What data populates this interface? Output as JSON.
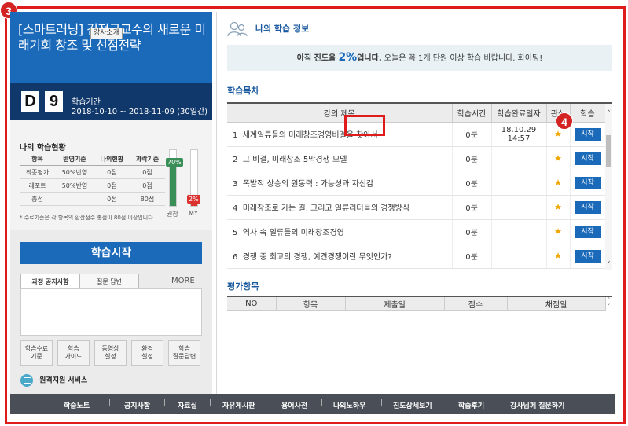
{
  "step_badges": {
    "a": "3",
    "b": "4"
  },
  "course": {
    "title": "[스마트러닝] 김정구교수의 새로운 미래기회 창조 및 선점전략",
    "intro_tag": "강사소개",
    "dday_letter": "D",
    "dday_number": "9",
    "period_label": "학습기간",
    "period_range": "2018-10-10 ~ 2018-11-09 (30일간)"
  },
  "status": {
    "title": "나의 학습현황",
    "headers": [
      "항목",
      "반영기준",
      "나의현황",
      "과락기준"
    ],
    "rows": [
      [
        "최종평가",
        "50%반영",
        "0점",
        "0점"
      ],
      [
        "레포트",
        "50%반영",
        "0점",
        "0점"
      ],
      [
        "총점",
        "",
        "0점",
        "80점"
      ]
    ],
    "bars": [
      {
        "label": "권장",
        "tag": "70%",
        "value": 70,
        "color": "#3a8f59",
        "tag_color": "#3a8f59"
      },
      {
        "label": "MY",
        "tag": "2%",
        "value": 2,
        "color": "#d9322f",
        "tag_color": "#d9322f"
      }
    ],
    "note": "* 수료기준은 각 항목의 환산점수 총점이 80점 이상입니다."
  },
  "start_button": "학습시작",
  "tabs": [
    {
      "label": "과정 공지사항"
    },
    {
      "label": "질문 답변"
    }
  ],
  "more": "MORE +",
  "quick_links": [
    {
      "line1": "학습수료",
      "line2": "기준"
    },
    {
      "line1": "학습",
      "line2": "가이드"
    },
    {
      "line1": "동영상",
      "line2": "설정"
    },
    {
      "line1": "환경",
      "line2": "설정"
    },
    {
      "line1": "학습",
      "line2": "질문답변"
    }
  ],
  "support": "원격지원 서비스",
  "info": {
    "title": "나의 학습 정보",
    "progress_prefix": "아직 진도율",
    "progress_value": "2%",
    "progress_suffix": "입니다.",
    "progress_message": " 오늘은 꼭 1개 단원 이상 학습 바랍니다. 화이팅!"
  },
  "lessons": {
    "title": "학습목차",
    "headers": [
      "강의 제목",
      "학습시간",
      "학습완료일자",
      "관심",
      "학습"
    ],
    "rows": [
      {
        "no": "1",
        "title": "세계일류들의 미래창조경영비결을 찾아서",
        "time": "0분",
        "done": "18.10.29 14:57",
        "star": "★",
        "btn": "시작"
      },
      {
        "no": "2",
        "title": "그 비결, 미래창조 5막경쟁 모델",
        "time": "0분",
        "done": "",
        "star": "★",
        "btn": "시작"
      },
      {
        "no": "3",
        "title": "폭발적 상승의 원동력 : 가능성과 자신감",
        "time": "0분",
        "done": "",
        "star": "★",
        "btn": "시작"
      },
      {
        "no": "4",
        "title": "미래창조로 가는 길, 그리고 일류리더들의 경쟁방식",
        "time": "0분",
        "done": "",
        "star": "★",
        "btn": "시작"
      },
      {
        "no": "5",
        "title": "역사 속 일류들의 미래창조경영",
        "time": "0분",
        "done": "",
        "star": "★",
        "btn": "시작"
      },
      {
        "no": "6",
        "title": "경쟁 중 최고의 경쟁, 예견경쟁이란 무엇인가?",
        "time": "0분",
        "done": "",
        "star": "★",
        "btn": "시작"
      }
    ]
  },
  "evaluation": {
    "title": "평가항목",
    "headers": [
      "NO",
      "항목",
      "제출일",
      "점수",
      "채점일"
    ]
  },
  "footer": [
    "학습노트",
    "공지사항",
    "자료실",
    "자유게시판",
    "용어사전",
    "나의노하우",
    "진도상세보기",
    "학습후기",
    "강사님께 질문하기"
  ],
  "colors": {
    "accent": "#1b6aba",
    "navy": "#11386b",
    "highlight": "#e01b1b",
    "star": "#f0a500"
  }
}
